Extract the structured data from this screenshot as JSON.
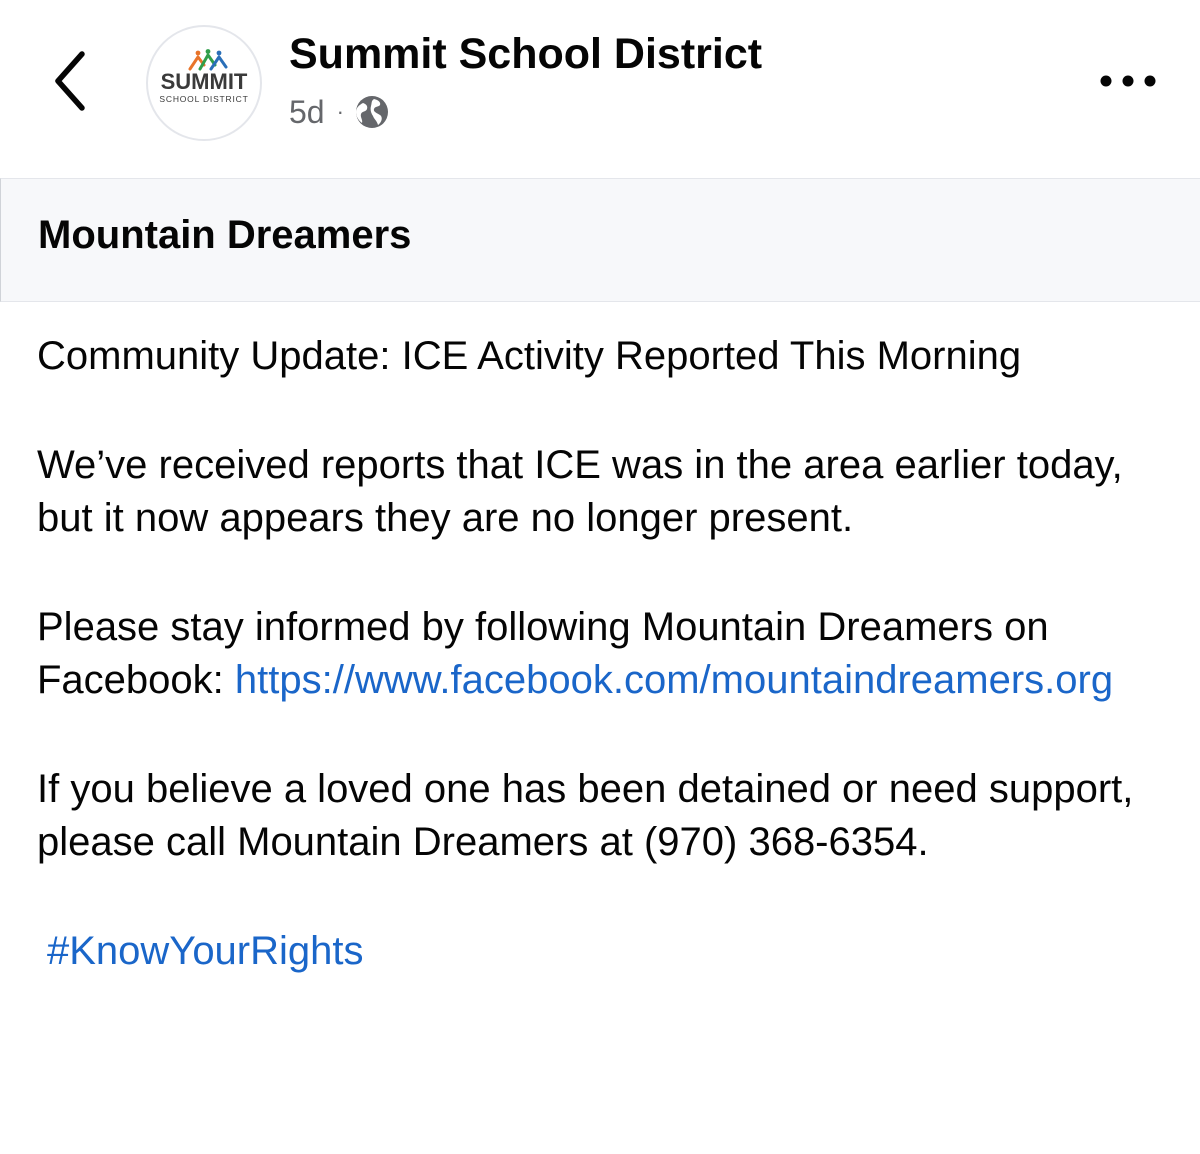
{
  "header": {
    "back_icon": "chevron-left-icon",
    "avatar": {
      "brand": "SUMMIT",
      "subtitle": "SCHOOL DISTRICT",
      "mark_colors": [
        "#e8742a",
        "#2f9e4a",
        "#2a6fb8"
      ]
    },
    "page_name": "Summit School District",
    "timestamp": "5d",
    "separator": "·",
    "audience_icon": "globe-icon",
    "more_icon": "more-horizontal-icon"
  },
  "post": {
    "title": "Mountain Dreamers",
    "headline": "Community Update: ICE Activity Reported This Morning",
    "paragraph_1": "We’ve received reports that ICE was in the area earlier today, but it now appears they are no longer present.",
    "paragraph_2_text": "Please stay informed by following Mountain Dreamers on Facebook: ",
    "paragraph_2_link": "https://www.facebook.com/mountaindreamers.org",
    "paragraph_3": "If you believe a loved one has been detained or need support, please call Mountain Dreamers at (970) 368-6354.",
    "hashtag": "#KnowYourRights"
  },
  "colors": {
    "link": "#1a66c9",
    "banner_background": "#f7f8fa",
    "meta_text": "#65676b"
  }
}
